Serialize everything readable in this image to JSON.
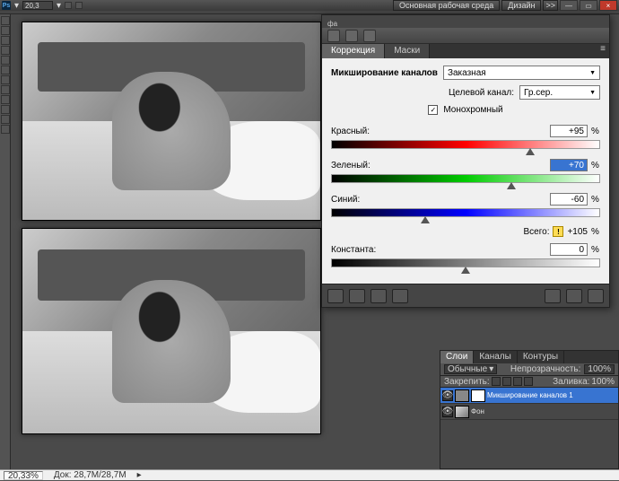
{
  "topbar": {
    "app_abbrev": "Ps",
    "zoom_input": "20,3",
    "workspace_main": "Основная рабочая среда",
    "workspace_design": "Дизайн",
    "chevrons": ">>",
    "minimize": "—",
    "maximize": "▭",
    "close": "×"
  },
  "option_icons": "фа",
  "panel": {
    "tab_correction": "Коррекция",
    "tab_masks": "Маски",
    "title": "Микширование каналов",
    "preset_label": "",
    "preset_value": "Заказная",
    "output_label": "Целевой канал:",
    "output_value": "Гр.сер.",
    "mono_label": "Монохромный",
    "mono_checked": "✓",
    "red_label": "Красный:",
    "red_value": "+95",
    "green_label": "Зеленый:",
    "green_value": "+70",
    "blue_label": "Синий:",
    "blue_value": "-60",
    "total_label": "Всего:",
    "total_warn": "⚠",
    "total_value": "+105",
    "constant_label": "Константа:",
    "constant_value": "0",
    "percent": "%"
  },
  "layers": {
    "tab_layers": "Слои",
    "tab_channels": "Каналы",
    "tab_paths": "Контуры",
    "blend_mode": "Обычные",
    "opacity_label": "Непрозрачность:",
    "opacity_value": "100%",
    "lock_label": "Закрепить:",
    "fill_label": "Заливка:",
    "fill_value": "100%",
    "layer1": "Микширование каналов 1",
    "layer2": "Фон"
  },
  "status": {
    "zoom": "20,33%",
    "docinfo": "Док: 28,7М/28,7М"
  }
}
